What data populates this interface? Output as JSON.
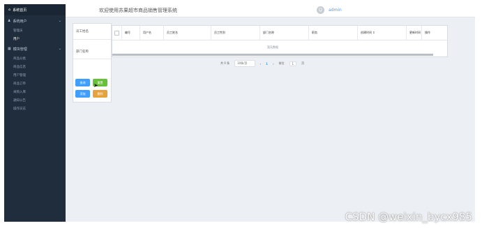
{
  "sidebar": {
    "home": "系统首页",
    "groups": [
      {
        "label": "系统用户",
        "items": [
          "管理员",
          "用户"
        ]
      },
      {
        "label": "模块管理",
        "items": [
          "商品分类",
          "商品信息",
          "用户管理",
          "商品订单",
          "采购入库",
          "通知公告",
          "操作日志"
        ]
      }
    ]
  },
  "header": {
    "welcome": "欢迎使用苏果超市商品销售管理系统",
    "username": "admin"
  },
  "filter": {
    "field1_label": "员工姓名",
    "field2_label": "部门名称",
    "search_label": "查询",
    "reset_label": "重置",
    "add_label": "添加",
    "delete_label": "删除"
  },
  "table": {
    "columns": [
      "",
      "编号",
      "用户名",
      "员工姓名",
      "员工性别",
      "部门名称",
      "职务",
      "创建时间 ↕",
      "更新时间",
      "操作"
    ],
    "empty_text": "暂无数据"
  },
  "pagination": {
    "total": "共 0 条",
    "page_size": "10条/页",
    "prev": "‹",
    "current": "1",
    "next": "›",
    "goto_prefix": "前往",
    "goto_value": "1",
    "goto_suffix": "页"
  },
  "watermark": "CSDN @weixin_bycx985"
}
